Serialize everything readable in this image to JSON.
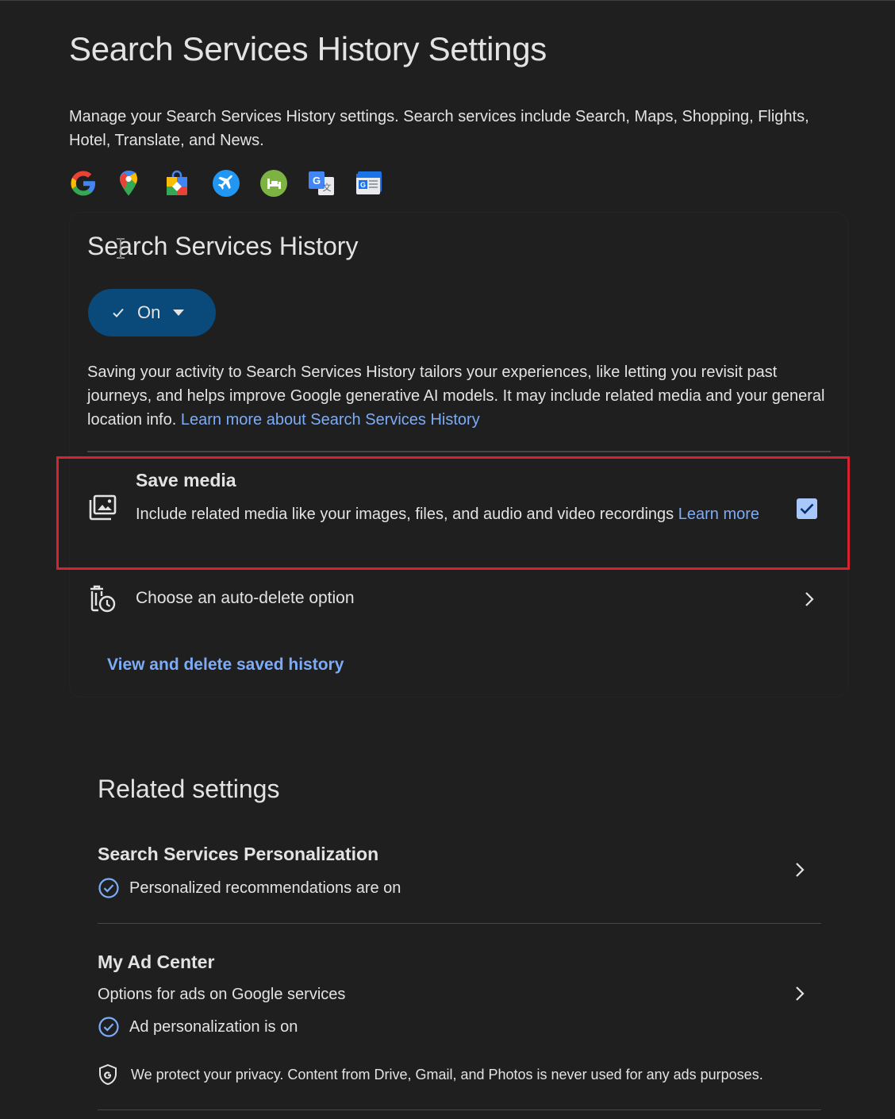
{
  "page": {
    "title": "Search Services History Settings",
    "description": "Manage your Search Services History settings. Search services include Search, Maps, Shopping, Flights, Hotel, Translate, and News."
  },
  "service_icons": [
    "google-search-icon",
    "google-maps-icon",
    "google-shopping-icon",
    "google-flights-icon",
    "google-hotels-icon",
    "google-translate-icon",
    "google-news-icon"
  ],
  "history_card": {
    "title": "Search Services History",
    "status_button_label": "On",
    "description": "Saving your activity to Search Services History tailors your experiences, like letting you revisit past journeys, and helps improve Google generative AI models. It may include related media and your general location info.",
    "learn_more_link": "Learn more about Search Services History",
    "save_media": {
      "title": "Save media",
      "description": "Include related media like your images, files, and audio and video recordings",
      "learn_more": "Learn more",
      "checked": true
    },
    "auto_delete_label": "Choose an auto-delete option",
    "view_delete_link": "View and delete saved history"
  },
  "related": {
    "title": "Related settings",
    "items": [
      {
        "title": "Search Services Personalization",
        "status": "Personalized recommendations are on"
      },
      {
        "title": "My Ad Center",
        "subtitle": "Options for ads on Google services",
        "status": "Ad personalization is on",
        "privacy_note": "We protect your privacy. Content from Drive, Gmail, and Photos is never used for any ads purposes."
      }
    ]
  },
  "colors": {
    "background": "#1f1f1f",
    "text": "#e3e3e3",
    "link": "#7cacf8",
    "on_button": "#0a4a7a",
    "highlight_border": "#d7232f",
    "checkbox": "#a8c7fa"
  }
}
